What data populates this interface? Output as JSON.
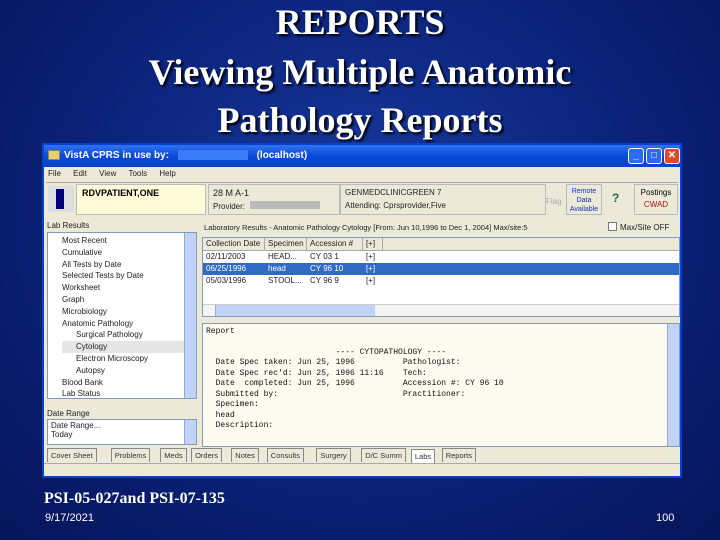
{
  "slide": {
    "title_lines": [
      "REPORTS",
      "Viewing Multiple Anatomic",
      "Pathology Reports"
    ],
    "footer_left": "PSI-05-027and PSI-07-135",
    "date": "9/17/2021",
    "page_number": "100"
  },
  "window": {
    "title": "VistA CPRS in use by:",
    "host": "(localhost)",
    "menu": [
      "File",
      "Edit",
      "View",
      "Tools",
      "Help"
    ]
  },
  "patient": {
    "name": "RDVPATIENT,ONE",
    "info": "28 M A-1",
    "provider_label": "Provider:",
    "location": "GENMEDCLINICGREEN 7",
    "attending": "Attending: Cprsprovider,Five",
    "flag_label": "Flag",
    "remote_data": "Remote Data Available",
    "postings_label": "Postings",
    "postings_value": "CWAD"
  },
  "lab_results": {
    "label": "Lab Results",
    "tree": [
      {
        "label": "Most Recent",
        "level": 0
      },
      {
        "label": "Cumulative",
        "level": 0
      },
      {
        "label": "All Tests by Date",
        "level": 0
      },
      {
        "label": "Selected Tests by Date",
        "level": 0
      },
      {
        "label": "Worksheet",
        "level": 0
      },
      {
        "label": "Graph",
        "level": 0
      },
      {
        "label": "Microbiology",
        "level": 0
      },
      {
        "label": "Anatomic Pathology",
        "level": 0
      },
      {
        "label": "Surgical Pathology",
        "level": 1
      },
      {
        "label": "Cytology",
        "level": 1,
        "selected": true
      },
      {
        "label": "Electron Microscopy",
        "level": 1
      },
      {
        "label": "Autopsy",
        "level": 1
      },
      {
        "label": "Blood Bank",
        "level": 0
      },
      {
        "label": "Lab Status",
        "level": 0
      }
    ]
  },
  "date_range": {
    "label": "Date Range",
    "items": [
      "Date Range...",
      "Today"
    ]
  },
  "results": {
    "header": "Laboratory Results - Anatomic Pathology Cytology [From: Jun 10,1996 to Dec 1, 2004] Max/site:5",
    "checkbox_label": "Max/Site OFF",
    "columns": [
      "Collection Date",
      "Specimen",
      "Accession #",
      "[+]"
    ],
    "rows": [
      [
        "02/11/2003",
        "HEAD...",
        "CY 03 1",
        "[+]"
      ],
      [
        "06/25/1996",
        "head",
        "CY 96 10",
        "[+]"
      ],
      [
        "05/03/1996",
        "STOOL...",
        "CY 96 9",
        "[+]"
      ]
    ],
    "selected_row": 1
  },
  "report": {
    "label": "Report",
    "lines": [
      "                           ---- CYTOPATHOLOGY ----",
      "  Date Spec taken: Jun 25, 1996          Pathologist:",
      "  Date Spec rec'd: Jun 25, 1996 11:16    Tech:",
      "  Date  completed: Jun 25, 1996          Accession #: CY 96 10",
      "  Submitted by:                          Practitioner:",
      "",
      "  Specimen:",
      "  head",
      "  Description:"
    ]
  },
  "tabs": {
    "items": [
      "Cover Sheet",
      "Problems",
      "Meds",
      "Orders",
      "Notes",
      "Consults",
      "Surgery",
      "D/C Summ",
      "Labs",
      "Reports"
    ],
    "active": "Labs"
  }
}
